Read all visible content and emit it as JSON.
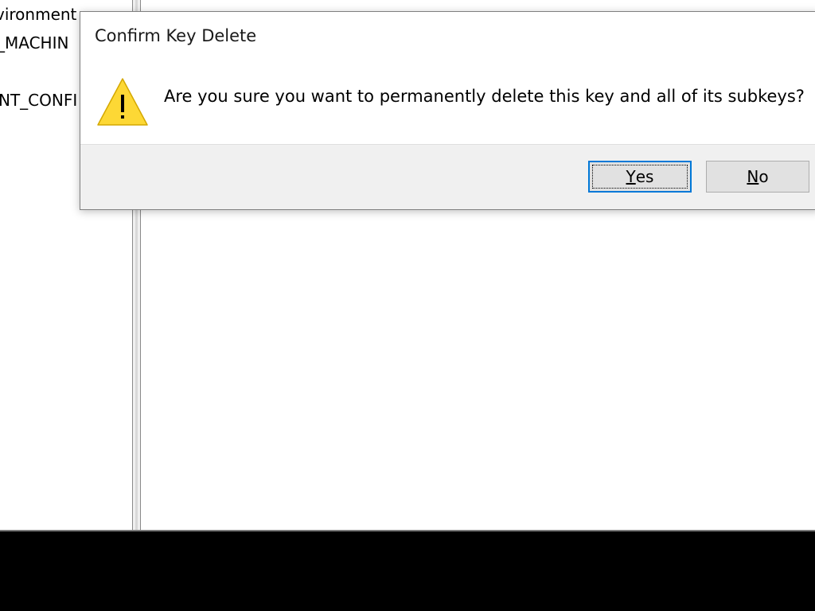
{
  "tree": {
    "items": [
      {
        "label": "vironment"
      },
      {
        "label": "_MACHIN"
      },
      {
        "label": "NT_CONFI"
      }
    ]
  },
  "dialog": {
    "title": "Confirm Key Delete",
    "message": "Are you sure you want to permanently delete this key and all of its subkeys?",
    "icon": "warning-icon",
    "buttons": {
      "yes": {
        "mnemonic": "Y",
        "rest": "es"
      },
      "no": {
        "mnemonic": "N",
        "rest": "o"
      }
    }
  },
  "colors": {
    "focus_border": "#0078d7",
    "button_bar": "#f0f0f0",
    "warning_fill": "#fdd835",
    "taskbar": "#000000"
  }
}
